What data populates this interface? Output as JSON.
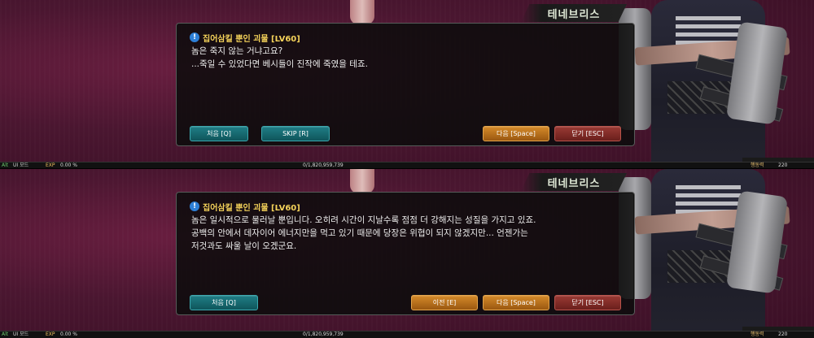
{
  "panels": [
    {
      "npc_name": "테네브리스",
      "dialog_title": "집어삼킬 뿐인 괴물 [LV60]",
      "lines": [
        "놈은 죽지 않는 거냐고요?",
        "...죽일 수 있었다면 베시들이 진작에 죽였을 테죠."
      ],
      "buttons": {
        "first": "처음 [Q]",
        "skip": "SKIP [R]",
        "next": "다음 [Space]",
        "close": "닫기 [ESC]"
      },
      "status": {
        "alt_label": "Alt",
        "ui_mode": "UI 모드",
        "exp_label": "EXP",
        "exp_percent": "0.00 %",
        "exp_value": "0/1,820,959,739",
        "action_label": "행동력",
        "action_value": "220"
      }
    },
    {
      "npc_name": "테네브리스",
      "dialog_title": "집어삼킬 뿐인 괴물 [LV60]",
      "lines": [
        "놈은 일시적으로 물러날 뿐입니다. 오히려 시간이 지날수록 점점 더 강해지는 성질을 가지고 있죠.",
        "공백의 안에서 데자이어 에너지만을 먹고 있기 때문에 당장은 위협이 되지 않겠지만... 언젠가는",
        "저것과도 싸울 날이 오겠군요."
      ],
      "buttons": {
        "first": "처음 [Q]",
        "prev": "이전 [E]",
        "next": "다음 [Space]",
        "close": "닫기 [ESC]"
      },
      "status": {
        "alt_label": "Alt",
        "ui_mode": "UI 모드",
        "exp_label": "EXP",
        "exp_percent": "0.00 %",
        "exp_value": "0/1,820,959,739",
        "action_label": "행동력",
        "action_value": "220"
      }
    }
  ],
  "colors": {
    "title_yellow": "#f5d35a",
    "teal_button": "#1f7e86",
    "orange_button": "#d58a2a",
    "red_button": "#9a3a34",
    "background": "#4a1630"
  }
}
